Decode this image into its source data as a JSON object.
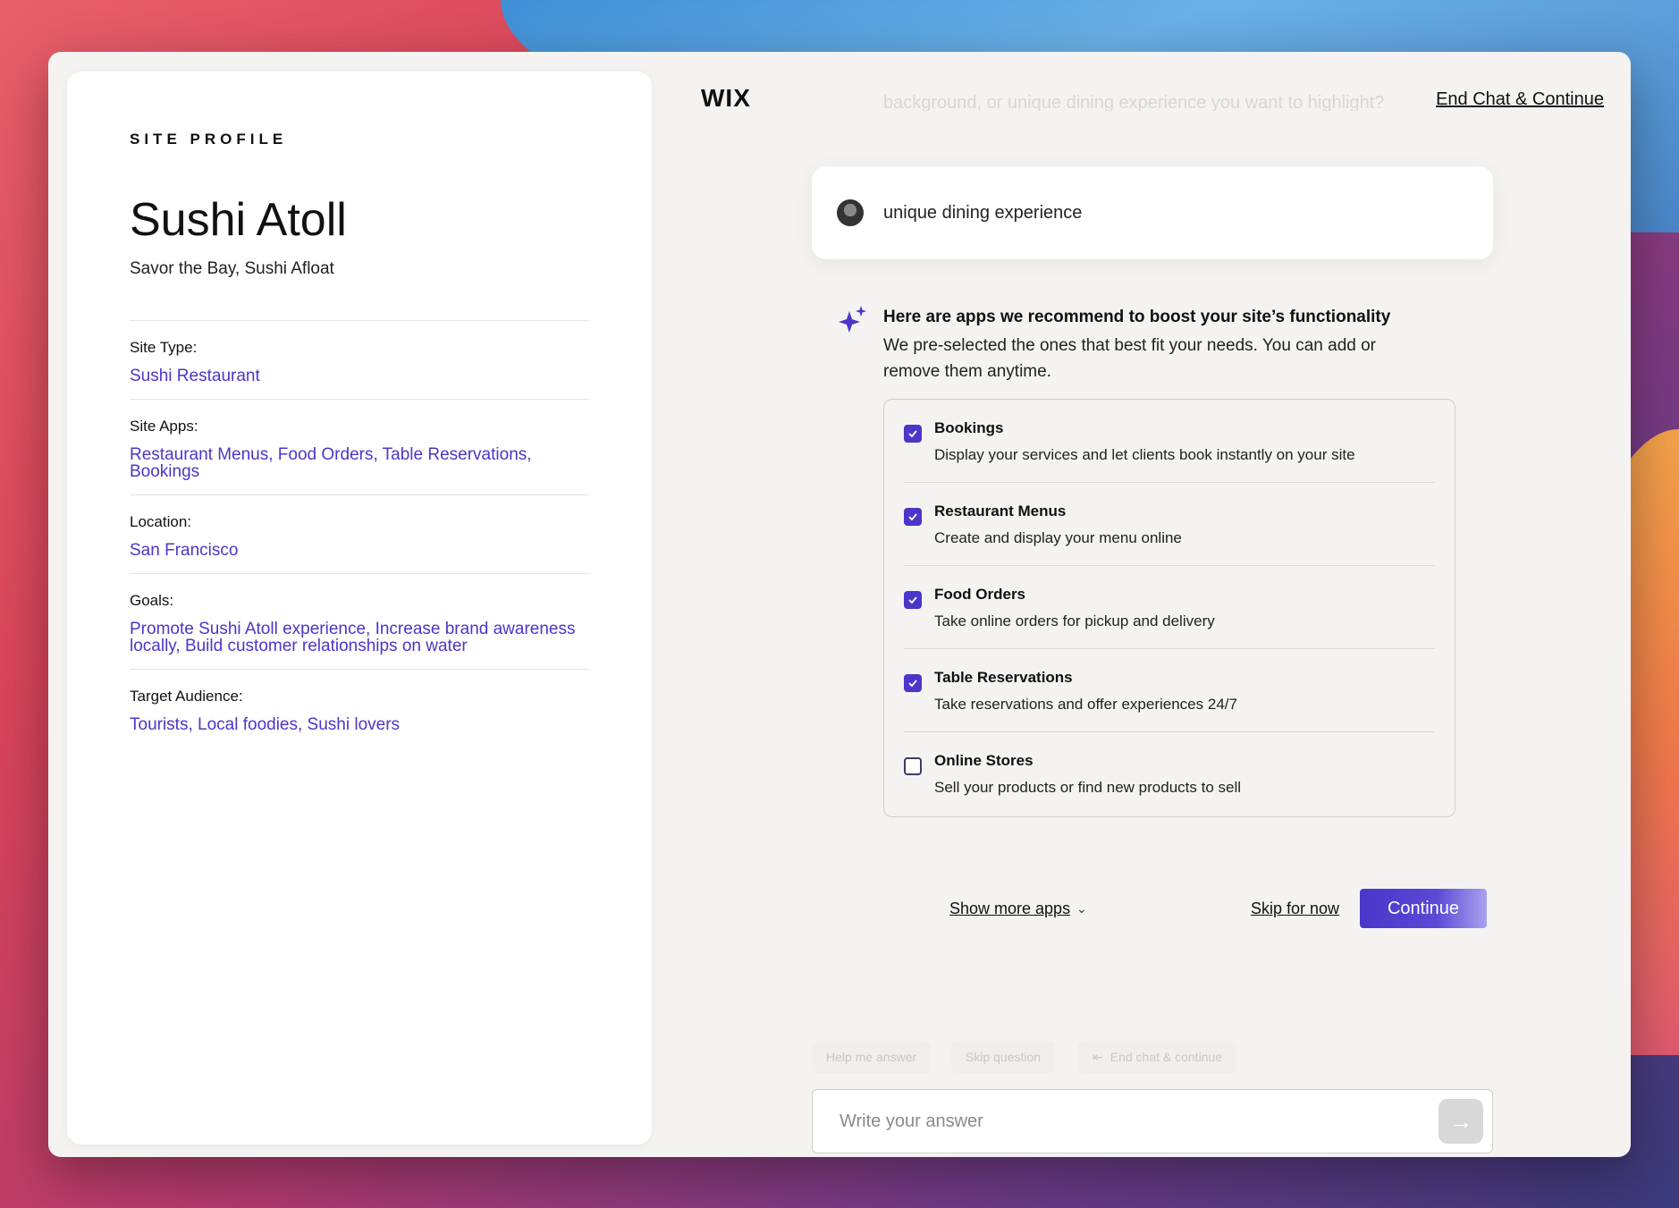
{
  "profile": {
    "heading": "SITE PROFILE",
    "site_name": "Sushi Atoll",
    "tagline": "Savor the Bay, Sushi Afloat",
    "fields": [
      {
        "label": "Site Type:",
        "value": "Sushi Restaurant"
      },
      {
        "label": "Site Apps:",
        "value": "Restaurant Menus, Food Orders, Table Reservations, Bookings"
      },
      {
        "label": "Location:",
        "value": "San Francisco"
      },
      {
        "label": "Goals:",
        "value": "Promote Sushi Atoll experience, Increase brand awareness locally, Build customer relationships on water"
      },
      {
        "label": "Target Audience:",
        "value": "Tourists, Local foodies, Sushi lovers"
      }
    ]
  },
  "header": {
    "logo": "WIX",
    "end_chat_label": "End Chat & Continue",
    "faded_question": "background, or unique dining experience you want to highlight?"
  },
  "chat": {
    "user_message": "unique dining experience",
    "rec_title": "Here are apps we recommend to boost your site’s functionality",
    "rec_subtitle": "We pre-selected the ones that best fit your needs. You can add or remove them anytime."
  },
  "apps": [
    {
      "name": "Bookings",
      "desc": "Display your services and let clients book instantly on your site",
      "checked": true
    },
    {
      "name": "Restaurant Menus",
      "desc": "Create and display your menu online",
      "checked": true
    },
    {
      "name": "Food Orders",
      "desc": "Take online orders for pickup and delivery",
      "checked": true
    },
    {
      "name": "Table Reservations",
      "desc": "Take reservations and offer experiences 24/7",
      "checked": true
    },
    {
      "name": "Online Stores",
      "desc": "Sell your products or find new products to sell",
      "checked": false
    }
  ],
  "actions": {
    "show_more": "Show more apps",
    "skip": "Skip for now",
    "continue": "Continue"
  },
  "chips": {
    "help": "Help me answer",
    "skip_question": "Skip question",
    "end_chat": "End chat & continue"
  },
  "answer": {
    "placeholder": "Write your answer"
  },
  "colors": {
    "accent": "#4a36c9",
    "panel_bg": "#f4f3f1"
  }
}
